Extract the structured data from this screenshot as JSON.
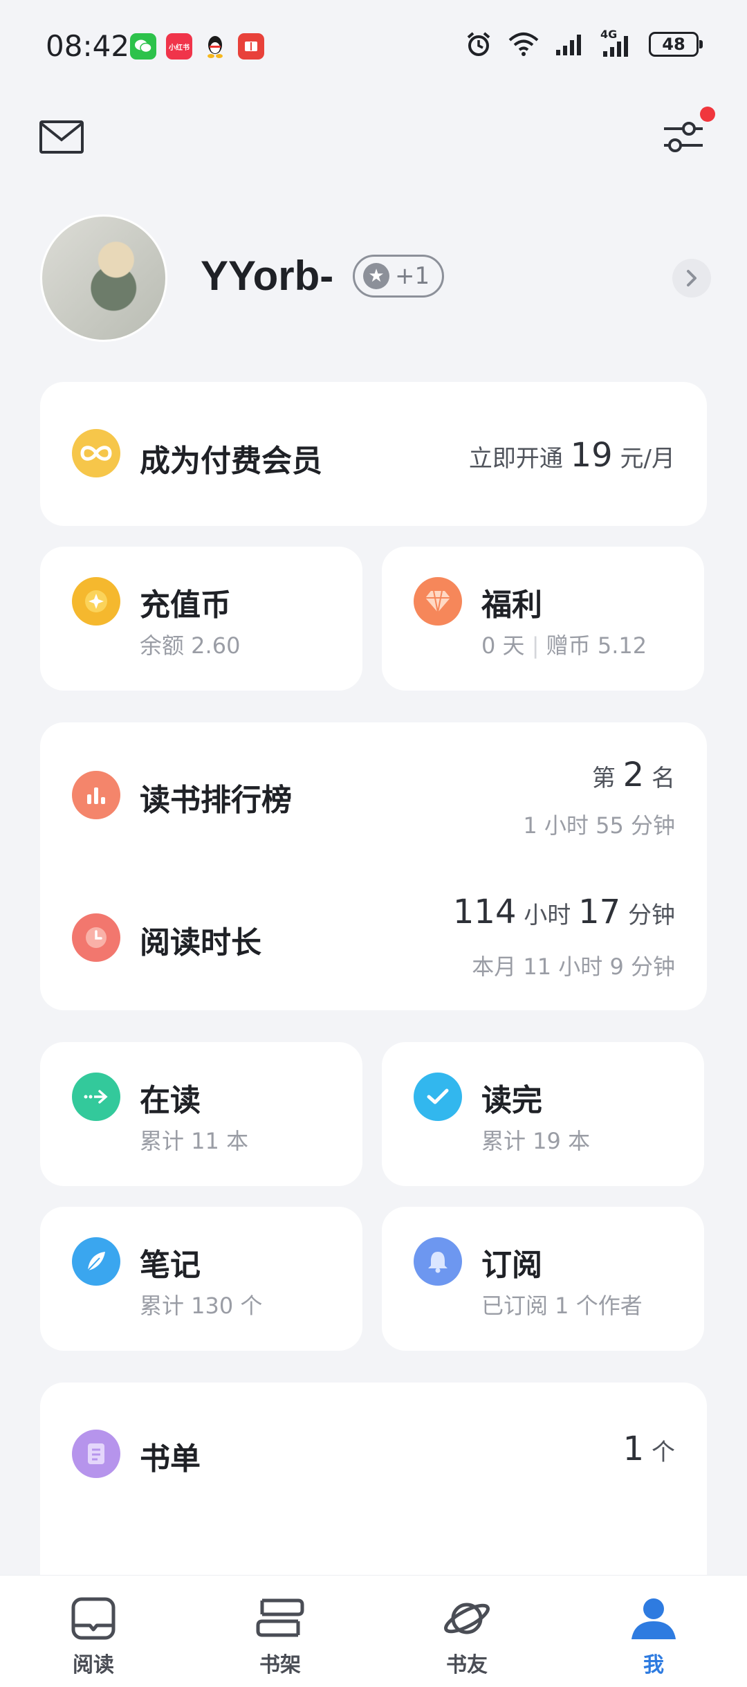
{
  "status_bar": {
    "time": "08:42",
    "notifications": [
      "wechat-icon",
      "xiaohongshu-icon",
      "qq-icon",
      "reader-icon"
    ],
    "xhs_label": "小红书",
    "battery": "48",
    "network": "4G"
  },
  "header": {
    "mail_icon": "mail-icon",
    "settings_icon": "sliders-icon",
    "has_notification": true
  },
  "profile": {
    "username": "YYorb-",
    "badge": "+1"
  },
  "membership": {
    "title": "成为付费会员",
    "prefix": "立即开通",
    "price": "19",
    "unit": "元/月"
  },
  "wallet": {
    "title": "充值币",
    "sub": "余额 2.60"
  },
  "welfare": {
    "title": "福利",
    "days": "0 天",
    "bonus": "赠币 5.12"
  },
  "ranking": {
    "title": "读书排行榜",
    "rank_prefix": "第",
    "rank": "2",
    "rank_suffix": "名",
    "sub": "1 小时 55 分钟"
  },
  "reading_time": {
    "title": "阅读时长",
    "hours": "114",
    "hours_unit": "小时",
    "minutes": "17",
    "minutes_unit": "分钟",
    "sub": "本月 11 小时 9 分钟"
  },
  "reading": {
    "title": "在读",
    "sub": "累计 11 本"
  },
  "finished": {
    "title": "读完",
    "sub": "累计 19 本"
  },
  "notes": {
    "title": "笔记",
    "sub": "累计 130 个"
  },
  "subscribe": {
    "title": "订阅",
    "sub": "已订阅 1 个作者"
  },
  "booklist": {
    "title": "书单",
    "count": "1",
    "unit": "个"
  },
  "bottom_nav": {
    "items": [
      {
        "label": "阅读",
        "icon": "book-open-icon"
      },
      {
        "label": "书架",
        "icon": "bookshelf-icon"
      },
      {
        "label": "书友",
        "icon": "planet-icon"
      },
      {
        "label": "我",
        "icon": "person-icon"
      }
    ],
    "active_color": "#2e7be0"
  },
  "colors": {
    "background": "#f3f4f7",
    "membership_icon": "#f6c64a",
    "wallet_icon": "#f5b82e",
    "welfare_icon": "#f6875a",
    "ranking_icon": "#f4856b",
    "time_icon": "#f2776e",
    "reading_icon": "#33c99b",
    "finished_icon": "#32b7ee",
    "notes_icon": "#3aa6ef",
    "subscribe_icon": "#6d97f0",
    "booklist_icon": "#b694ec"
  }
}
